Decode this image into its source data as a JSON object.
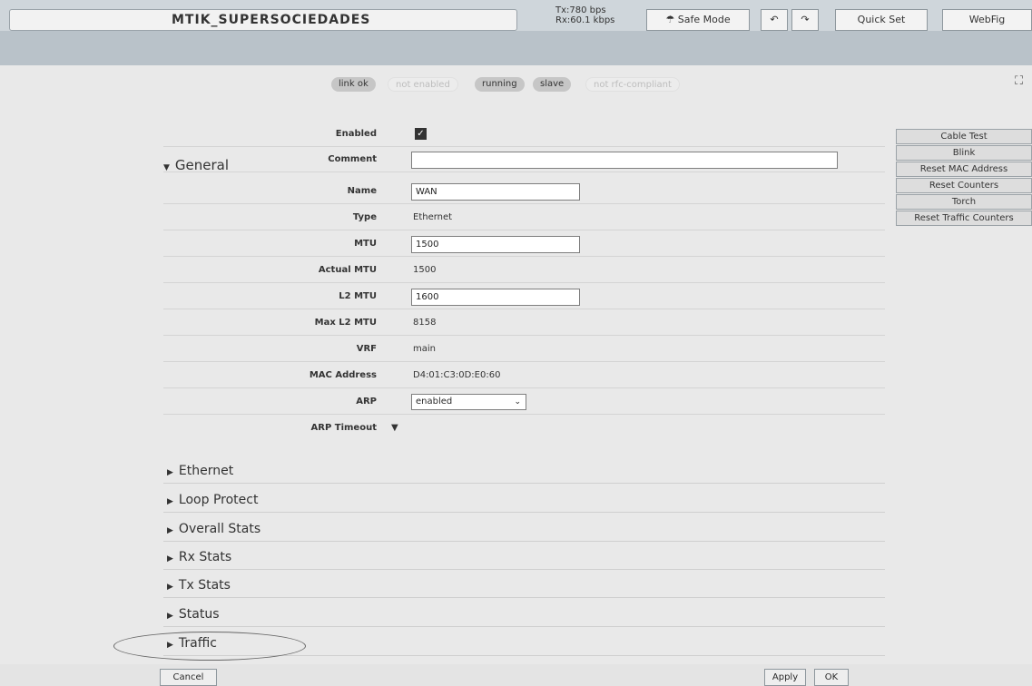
{
  "header": {
    "identity": "MTIK_SUPERSOCIEDADES",
    "tx": "Tx:780 bps",
    "rx": "Rx:60.1 kbps",
    "safe_mode": "Safe Mode",
    "quick_set": "Quick Set",
    "webfig": "WebFig",
    "undo_icon": "undo-icon",
    "redo_icon": "redo-icon"
  },
  "flags": [
    "link ok",
    "not enabled",
    "running",
    "slave",
    "not rfc-compliant"
  ],
  "flags_on": [
    true,
    false,
    true,
    true,
    false
  ],
  "form": {
    "enabled_label": "Enabled",
    "comment_label": "Comment",
    "comment_value": "",
    "general_section": "General",
    "fields": [
      {
        "label": "Name",
        "value": "WAN",
        "kind": "input"
      },
      {
        "label": "Type",
        "value": "Ethernet",
        "kind": "text"
      },
      {
        "label": "MTU",
        "value": "1500",
        "kind": "input"
      },
      {
        "label": "Actual MTU",
        "value": "1500",
        "kind": "text"
      },
      {
        "label": "L2 MTU",
        "value": "1600",
        "kind": "input"
      },
      {
        "label": "Max L2 MTU",
        "value": "8158",
        "kind": "text"
      },
      {
        "label": "VRF",
        "value": "main",
        "kind": "text"
      },
      {
        "label": "MAC Address",
        "value": "D4:01:C3:0D:E0:60",
        "kind": "text"
      },
      {
        "label": "ARP",
        "value": "enabled",
        "kind": "select"
      }
    ],
    "arp_timeout_label": "ARP Timeout"
  },
  "sections": [
    "Ethernet",
    "Loop Protect",
    "Overall Stats",
    "Rx Stats",
    "Tx Stats",
    "Status",
    "Traffic"
  ],
  "actions": [
    "Cable Test",
    "Blink",
    "Reset MAC Address",
    "Reset Counters",
    "Torch",
    "Reset Traffic Counters"
  ],
  "footer": {
    "cancel": "Cancel",
    "apply": "Apply",
    "ok": "OK"
  }
}
